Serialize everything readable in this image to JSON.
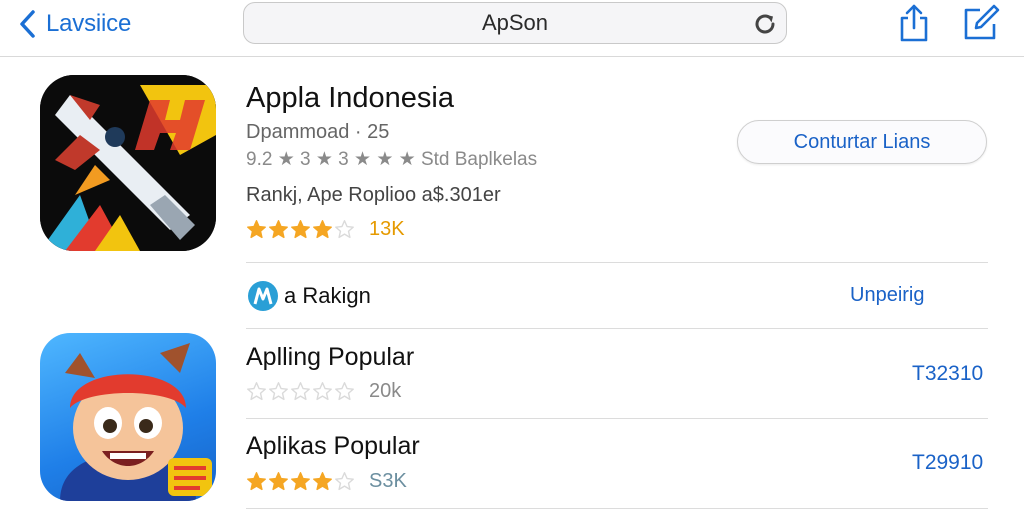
{
  "toolbar": {
    "back_label": "Lavsiice",
    "url_text": "ApSon"
  },
  "featured": {
    "title": "Appla Indonesia",
    "subtitle": "Dpammoad · 25",
    "rating_text": "9.2 ★ 3 ★ 3 ★ ★ ★  Std Baplkelas",
    "ranking": "Rankj, Ape Roplioo a$.301er",
    "rating_stars": 4,
    "rating_count": "13K",
    "action_label": "Conturtar Lians"
  },
  "section": {
    "label": "a Rakign",
    "link": "Unpeirig"
  },
  "list": [
    {
      "title": "Aplling Popular",
      "rating_stars": 0,
      "count": "20k",
      "price": "T32310"
    },
    {
      "title": "Aplikas Popular",
      "rating_stars": 4,
      "count": "S3K",
      "price": "T29910"
    }
  ],
  "colors": {
    "accent": "#1a62c7",
    "star": "#f5a623",
    "star_empty": "#dadada"
  }
}
